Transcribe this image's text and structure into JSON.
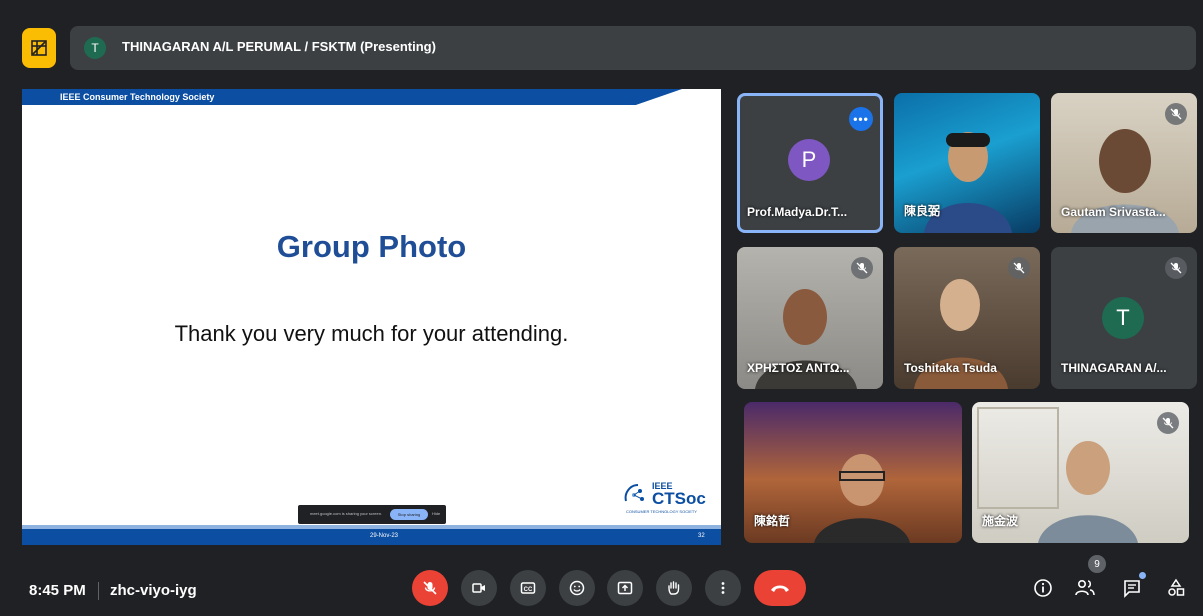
{
  "presenter": {
    "initial": "T",
    "label": "THINAGARAN A/L PERUMAL / FSKTM (Presenting)"
  },
  "slide": {
    "society": "IEEE Consumer Technology Society",
    "title": "Group Photo",
    "text": "Thank you very much for your attending.",
    "logo_ieee": "IEEE",
    "logo_ctsoc": "CTSoc",
    "logo_sub": "CONSUMER TECHNOLOGY SOCIETY",
    "share_text": "meet.google.com is sharing your screen.",
    "stop_sharing": "Stop sharing",
    "hide": "Hide",
    "date": "29-Nov-23",
    "page": "32"
  },
  "participants": [
    {
      "name": "Prof.Madya.Dr.T...",
      "initial": "P",
      "avatar_color": "#7e57c2"
    },
    {
      "name": "陳良弼"
    },
    {
      "name": "Gautam Srivasta..."
    },
    {
      "name": "ΧΡΗΣΤΟΣ ΑΝΤΩ..."
    },
    {
      "name": "Toshitaka Tsuda"
    },
    {
      "name": "THINAGARAN A/...",
      "initial": "T",
      "avatar_color": "#1e6b52"
    },
    {
      "name": "陳銘哲"
    },
    {
      "name": "施金波"
    }
  ],
  "meeting": {
    "time": "8:45 PM",
    "code": "zhc-viyo-iyg",
    "people_count": "9"
  },
  "colors": {
    "accent": "#1a73e8",
    "hangup": "#ea4335",
    "layout": "#fbbc04"
  }
}
